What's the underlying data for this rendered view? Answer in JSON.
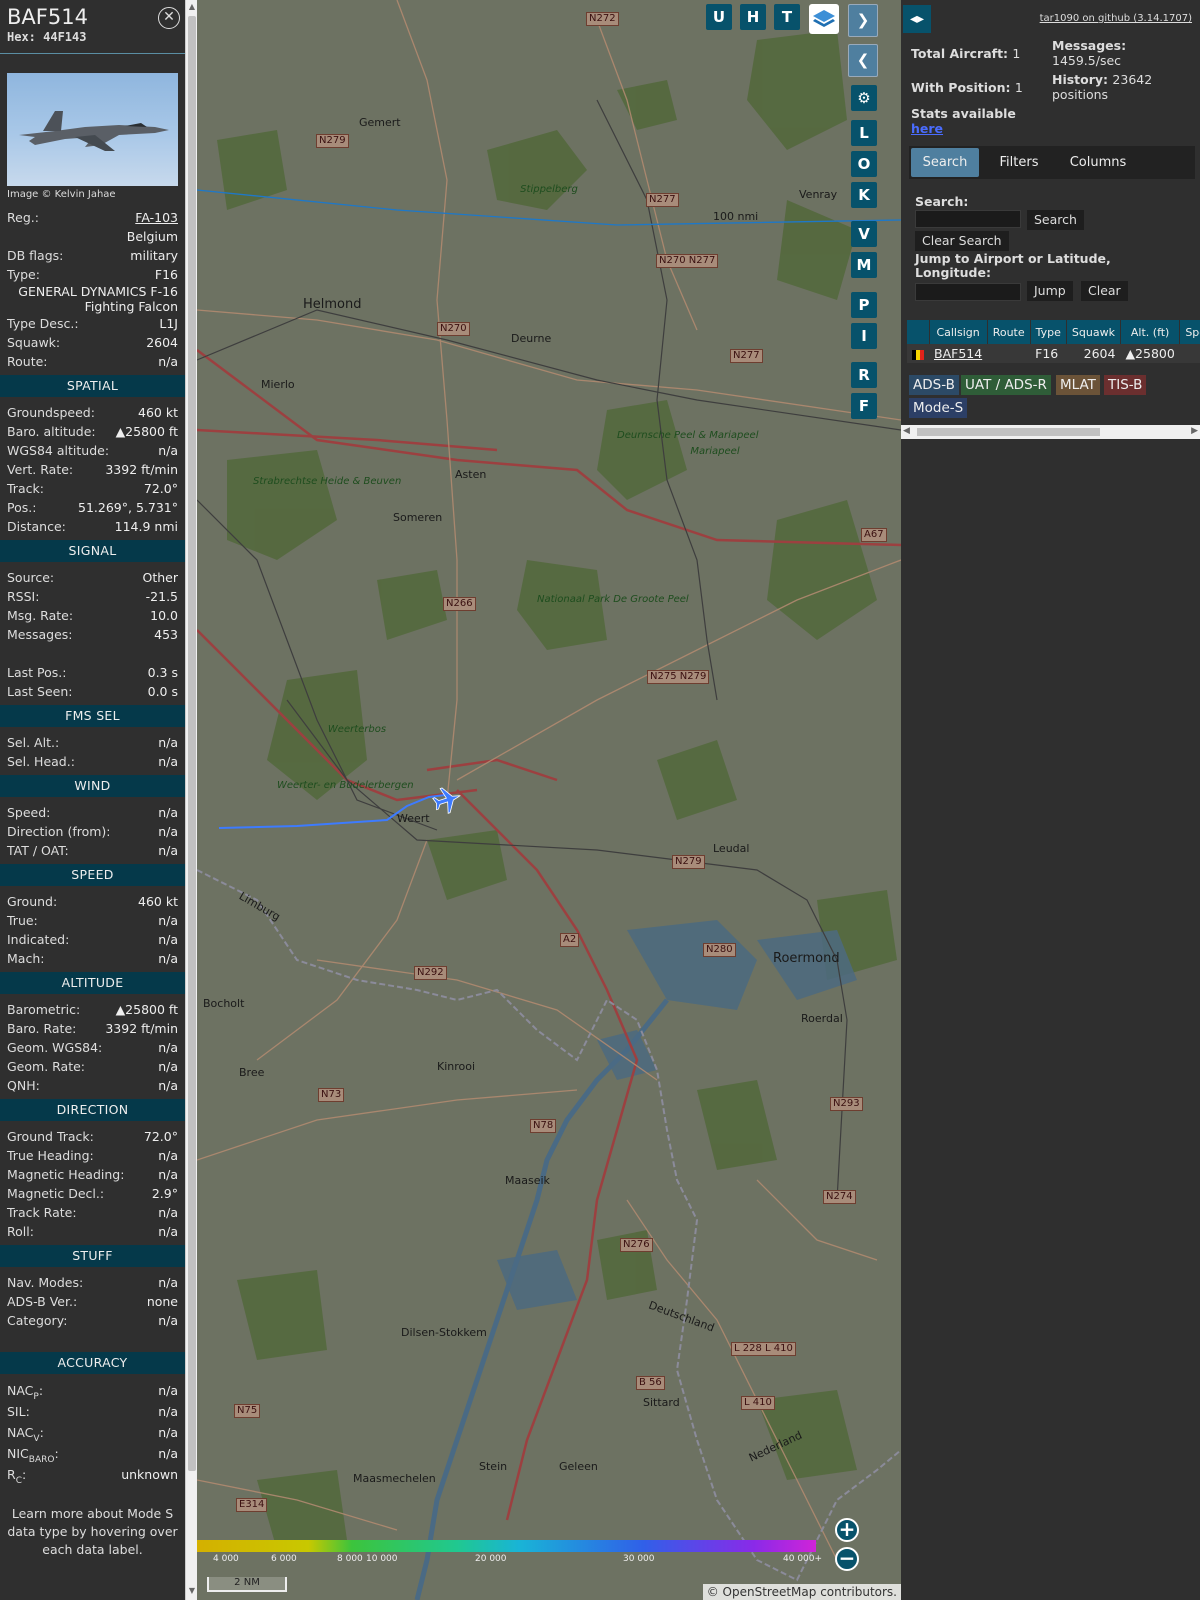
{
  "info": {
    "callsign": "BAF514",
    "hex": "Hex: 44F143",
    "photo_credit": "Image © Kelvin Jahae",
    "rows_top": [
      {
        "k": "Reg.:",
        "v": "FA-103",
        "link": true
      },
      {
        "k": "",
        "v": "Belgium"
      },
      {
        "k": "DB flags:",
        "v": "military"
      },
      {
        "k": "Type:",
        "v": "F16"
      }
    ],
    "type_full": "GENERAL DYNAMICS F-16 Fighting Falcon",
    "rows_top2": [
      {
        "k": "Type Desc.:",
        "v": "L1J"
      },
      {
        "k": "Squawk:",
        "v": "2604"
      },
      {
        "k": "Route:",
        "v": "n/a"
      }
    ],
    "sections": [
      {
        "title": "SPATIAL",
        "rows": [
          {
            "k": "Groundspeed:",
            "v": "460 kt"
          },
          {
            "k": "Baro. altitude:",
            "v": "▲25800 ft"
          },
          {
            "k": "WGS84 altitude:",
            "v": "n/a"
          },
          {
            "k": "Vert. Rate:",
            "v": "3392 ft/min"
          },
          {
            "k": "Track:",
            "v": "72.0°"
          },
          {
            "k": "Pos.:",
            "v": "51.269°, 5.731°"
          },
          {
            "k": "Distance:",
            "v": "114.9 nmi"
          }
        ]
      },
      {
        "title": "SIGNAL",
        "rows": [
          {
            "k": "Source:",
            "v": "Other"
          },
          {
            "k": "RSSI:",
            "v": "-21.5"
          },
          {
            "k": "Msg. Rate:",
            "v": "10.0"
          },
          {
            "k": "Messages:",
            "v": "453"
          },
          {
            "k": "",
            "v": ""
          },
          {
            "k": "Last Pos.:",
            "v": "0.3 s"
          },
          {
            "k": "Last Seen:",
            "v": "0.0 s"
          }
        ]
      },
      {
        "title": "FMS SEL",
        "rows": [
          {
            "k": "Sel. Alt.:",
            "v": "n/a"
          },
          {
            "k": "Sel. Head.:",
            "v": "n/a"
          }
        ]
      },
      {
        "title": "WIND",
        "rows": [
          {
            "k": "Speed:",
            "v": "n/a"
          },
          {
            "k": "Direction (from):",
            "v": "n/a"
          },
          {
            "k": "TAT / OAT:",
            "v": "n/a"
          }
        ]
      },
      {
        "title": "SPEED",
        "rows": [
          {
            "k": "Ground:",
            "v": "460 kt"
          },
          {
            "k": "True:",
            "v": "n/a"
          },
          {
            "k": "Indicated:",
            "v": "n/a"
          },
          {
            "k": "Mach:",
            "v": "n/a"
          }
        ]
      },
      {
        "title": "ALTITUDE",
        "rows": [
          {
            "k": "Barometric:",
            "v": "▲25800 ft"
          },
          {
            "k": "Baro. Rate:",
            "v": "3392 ft/min"
          },
          {
            "k": "Geom. WGS84:",
            "v": "n/a"
          },
          {
            "k": "Geom. Rate:",
            "v": "n/a"
          },
          {
            "k": "QNH:",
            "v": "n/a"
          }
        ]
      },
      {
        "title": "DIRECTION",
        "rows": [
          {
            "k": "Ground Track:",
            "v": "72.0°"
          },
          {
            "k": "True Heading:",
            "v": "n/a"
          },
          {
            "k": "Magnetic Heading:",
            "v": "n/a"
          },
          {
            "k": "Magnetic Decl.:",
            "v": "2.9°"
          },
          {
            "k": "Track Rate:",
            "v": "n/a"
          },
          {
            "k": "Roll:",
            "v": "n/a"
          }
        ]
      },
      {
        "title": "STUFF",
        "rows": [
          {
            "k": "Nav. Modes:",
            "v": "n/a"
          },
          {
            "k": "ADS-B Ver.:",
            "v": "none"
          },
          {
            "k": "Category:",
            "v": "n/a"
          }
        ]
      }
    ],
    "accuracy": {
      "title": "ACCURACY",
      "rows": [
        {
          "k": "NAC",
          "sub": "P",
          "v": "n/a"
        },
        {
          "k": "SIL:",
          "sub": "",
          "v": "n/a"
        },
        {
          "k": "NAC",
          "sub": "V",
          "v": "n/a"
        },
        {
          "k": "NIC",
          "sub": "BARO",
          "v": "n/a"
        },
        {
          "k": "R",
          "sub": "C",
          "v": "unknown"
        }
      ]
    },
    "note": "Learn more about Mode S data type by hovering over each data label."
  },
  "map": {
    "buttons_top": [
      "U",
      "H",
      "T"
    ],
    "buttons_side": [
      "L",
      "O",
      "K",
      "V",
      "M",
      "P",
      "I",
      "R",
      "F"
    ],
    "range_label": "100 nmi",
    "scale": "2 NM",
    "attribution_prefix": "©",
    "attribution_link": "OpenStreetMap",
    "attribution_suffix": "contributors.",
    "legend_labels": [
      "4 000",
      "6 000",
      "8 000",
      "10 000",
      "20 000",
      "30 000",
      "40 000+"
    ],
    "places": [
      {
        "t": "Gemert",
        "big": false
      },
      {
        "t": "Helmond",
        "big": true
      },
      {
        "t": "Deurne",
        "big": false
      },
      {
        "t": "Mierlo",
        "big": false
      },
      {
        "t": "Asten",
        "big": false
      },
      {
        "t": "Someren",
        "big": false
      },
      {
        "t": "Venray",
        "big": false
      },
      {
        "t": "Weert",
        "big": false
      },
      {
        "t": "Roermond",
        "big": true
      },
      {
        "t": "Bocholt",
        "big": false
      },
      {
        "t": "Bree",
        "big": false
      },
      {
        "t": "Kinrooi",
        "big": false
      },
      {
        "t": "Maaseik",
        "big": false
      },
      {
        "t": "Dilsen-Stokkem",
        "big": false
      },
      {
        "t": "Sittard",
        "big": false
      },
      {
        "t": "Stein",
        "big": false
      },
      {
        "t": "Geleen",
        "big": false
      },
      {
        "t": "Maasmechelen",
        "big": false
      },
      {
        "t": "Leudal",
        "big": false
      },
      {
        "t": "Roerdal",
        "big": false
      },
      {
        "t": "Limburg",
        "big": false
      },
      {
        "t": "Deutschland",
        "big": false
      },
      {
        "t": "Nederland",
        "big": false
      }
    ],
    "parks": [
      "Stippelberg",
      "Deurnsche Peel & Mariapeel",
      "Strabrechtse Heide & Beuven",
      "Nationaal Park De Groote Peel",
      "Weerterbos",
      "Weerter- en Budelerbergen",
      "Mariapeel"
    ],
    "roads": [
      "N272",
      "N279",
      "N277",
      "N270 N277",
      "N270",
      "N277",
      "N266",
      "N275 N279",
      "N279",
      "N280",
      "A2",
      "N292",
      "N73",
      "N78",
      "N276",
      "N274",
      "N293",
      "B 56",
      "L 228 L 410",
      "L 410",
      "N75",
      "E314",
      "A67"
    ]
  },
  "sidebar": {
    "github": "tar1090 on github (3.14.1707)",
    "total_label": "Total Aircraft:",
    "total": "1",
    "pos_label": "With Position:",
    "pos": "1",
    "msg_label": "Messages:",
    "msg": "1459.5/sec",
    "hist_label": "History:",
    "hist": "23642 positions",
    "stats_text": "Stats available",
    "stats_link": "here",
    "tabs": [
      "Search",
      "Filters",
      "Columns"
    ],
    "search_label": "Search:",
    "search_btn": "Search",
    "clear_search_btn": "Clear Search",
    "jump_label": "Jump to Airport or Latitude, Longitude:",
    "jump_btn": "Jump",
    "clear_btn": "Clear",
    "columns": [
      "Callsign",
      "Route",
      "Type",
      "Squawk",
      "Alt. (ft)",
      "Spd"
    ],
    "rows": [
      {
        "callsign": "BAF514",
        "route": "",
        "type": "F16",
        "squawk": "2604",
        "alt": "▲25800"
      }
    ],
    "sources": [
      {
        "t": "ADS-B",
        "c": "#2c4a66"
      },
      {
        "t": "UAT / ADS-R",
        "c": "#2f5d38"
      },
      {
        "t": "MLAT",
        "c": "#6b5338"
      },
      {
        "t": "TIS-B",
        "c": "#6b2f2f"
      },
      {
        "t": "Mode-S",
        "c": "#2c3f66"
      }
    ]
  },
  "colors": {
    "accent": "#07526b",
    "active_tab": "#4f7f9f",
    "track": "#3d7bff"
  }
}
